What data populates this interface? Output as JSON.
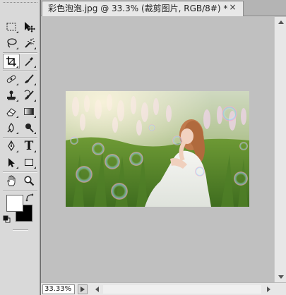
{
  "document": {
    "tab_title": "彩色泡泡.jpg @ 33.3% (裁剪图片, RGB/8#) *",
    "close_glyph": "×",
    "zoom_level": "33.33%"
  },
  "toolbox": {
    "tools": [
      {
        "name": "rectangular-marquee-tool",
        "active": false
      },
      {
        "name": "move-tool",
        "active": false
      },
      {
        "name": "lasso-tool",
        "active": false
      },
      {
        "name": "magic-wand-tool",
        "active": false
      },
      {
        "name": "crop-tool",
        "active": true
      },
      {
        "name": "eyedropper-tool",
        "active": false
      },
      {
        "name": "spot-healing-brush-tool",
        "active": false
      },
      {
        "name": "brush-tool",
        "active": false
      },
      {
        "name": "clone-stamp-tool",
        "active": false
      },
      {
        "name": "history-brush-tool",
        "active": false
      },
      {
        "name": "eraser-tool",
        "active": false
      },
      {
        "name": "gradient-tool",
        "active": false
      },
      {
        "name": "blur-tool",
        "active": false
      },
      {
        "name": "dodge-tool",
        "active": false
      },
      {
        "name": "pen-tool",
        "active": false
      },
      {
        "name": "type-tool",
        "active": false
      },
      {
        "name": "path-selection-tool",
        "active": false
      },
      {
        "name": "rectangle-shape-tool",
        "active": false
      },
      {
        "name": "hand-tool",
        "active": false
      },
      {
        "name": "zoom-tool",
        "active": false
      }
    ],
    "type_tool_glyph": "T",
    "foreground_color": "#ffffff",
    "background_color": "#000000"
  }
}
